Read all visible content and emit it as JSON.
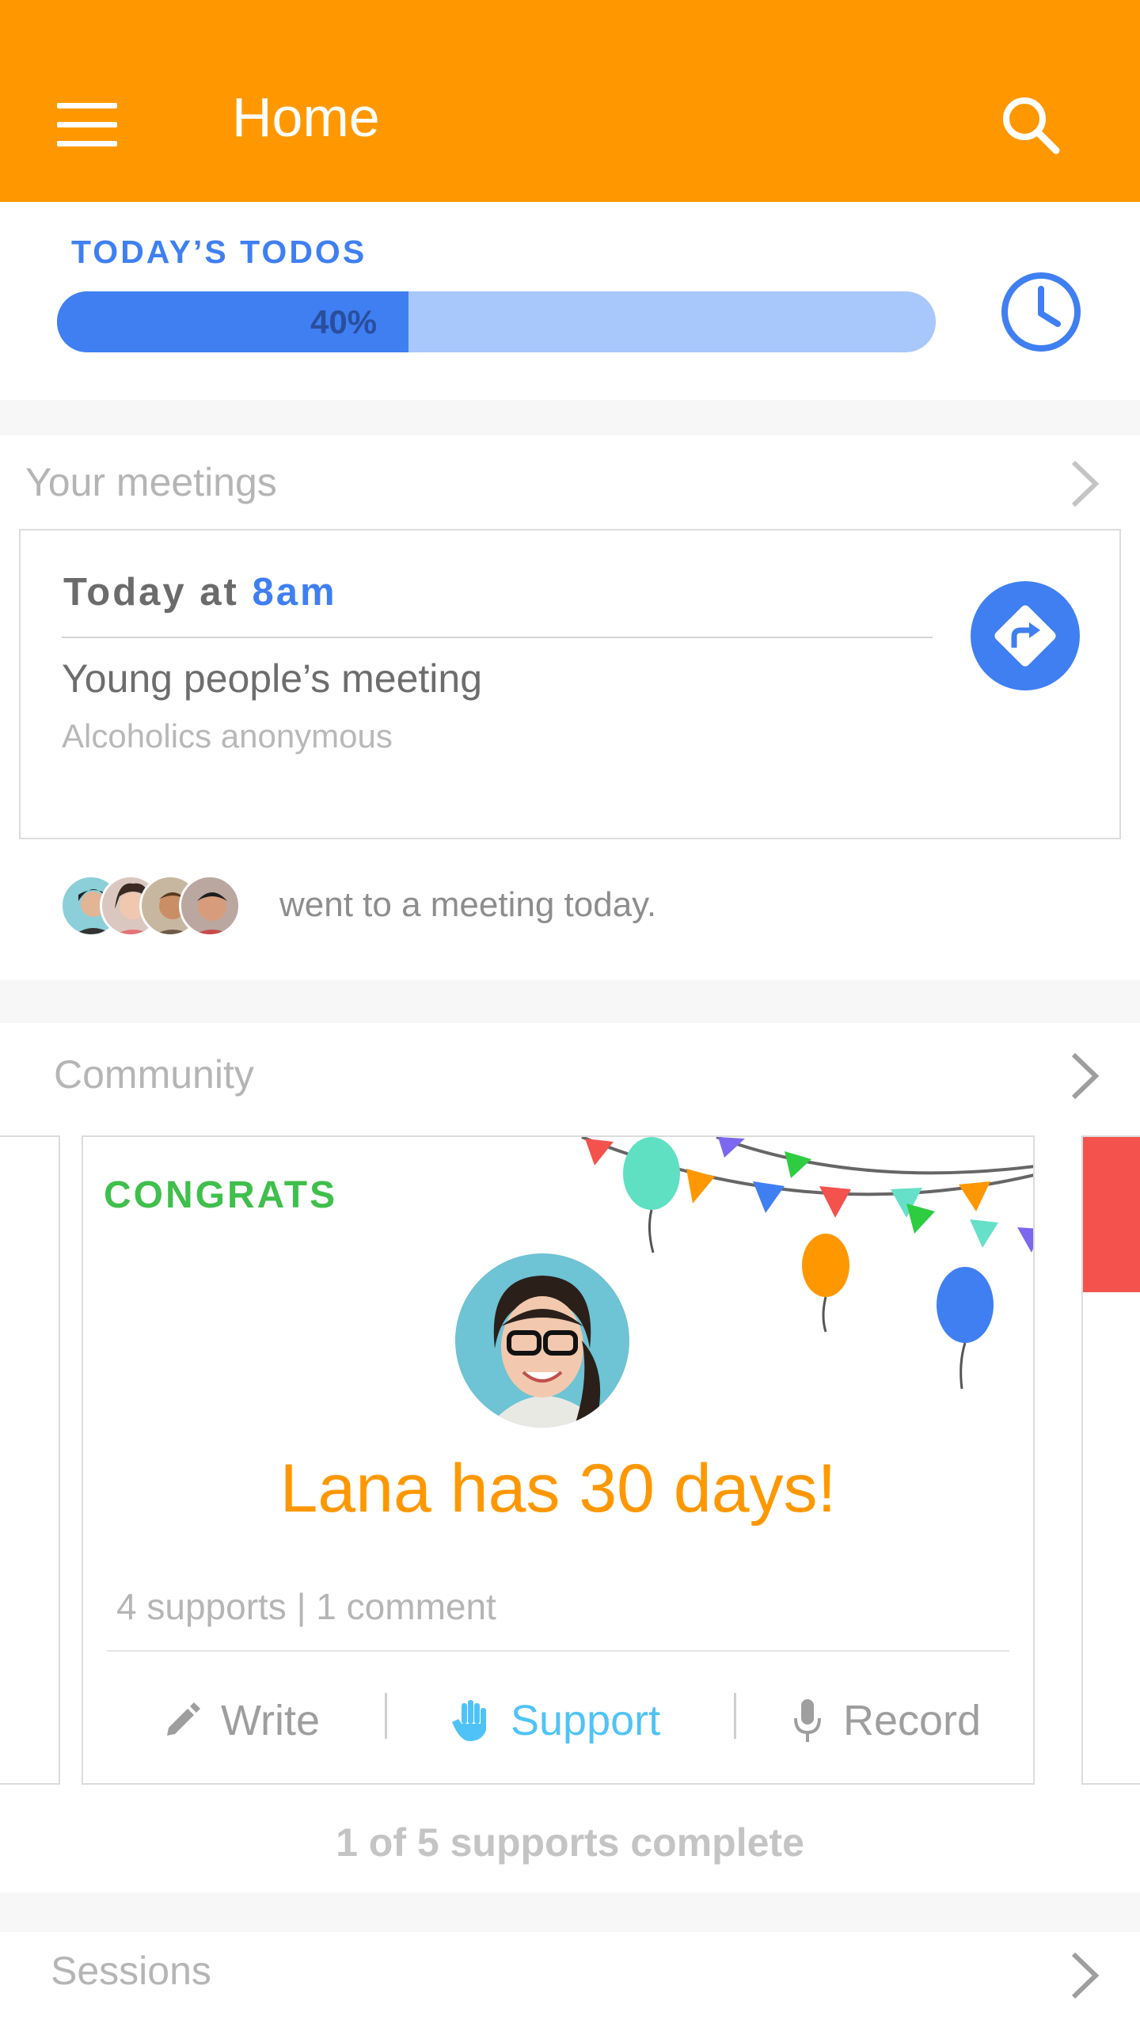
{
  "appbar": {
    "title": "Home",
    "color": "#ff9800"
  },
  "todos": {
    "label": "TODAY’S TODOS",
    "progress_percent": 40,
    "progress_text": "40%"
  },
  "meetings": {
    "title": "Your meetings",
    "card": {
      "when_prefix": "Today at",
      "time": "8am",
      "name": "Young people’s meeting",
      "organization": "Alcoholics anonymous"
    },
    "attendance_text": "went to a meeting today."
  },
  "community": {
    "title": "Community",
    "card": {
      "label": "CONGRATS",
      "milestone": "Lana has 30 days!",
      "stats": "4 supports | 1 comment",
      "actions": {
        "write": "Write",
        "support": "Support",
        "record": "Record"
      }
    },
    "supports_complete": "1 of 5 supports complete"
  },
  "sessions": {
    "title": "Sessions"
  },
  "colors": {
    "accent_blue": "#3f7ff2",
    "orange": "#ff9800",
    "green": "#3fbf4c",
    "support_cyan": "#4fc3f7",
    "red": "#f4524d"
  },
  "icons": [
    "menu-icon",
    "search-icon",
    "clock-icon",
    "chevron-right-icon",
    "directions-icon",
    "pencil-icon",
    "hand-icon",
    "microphone-icon"
  ]
}
